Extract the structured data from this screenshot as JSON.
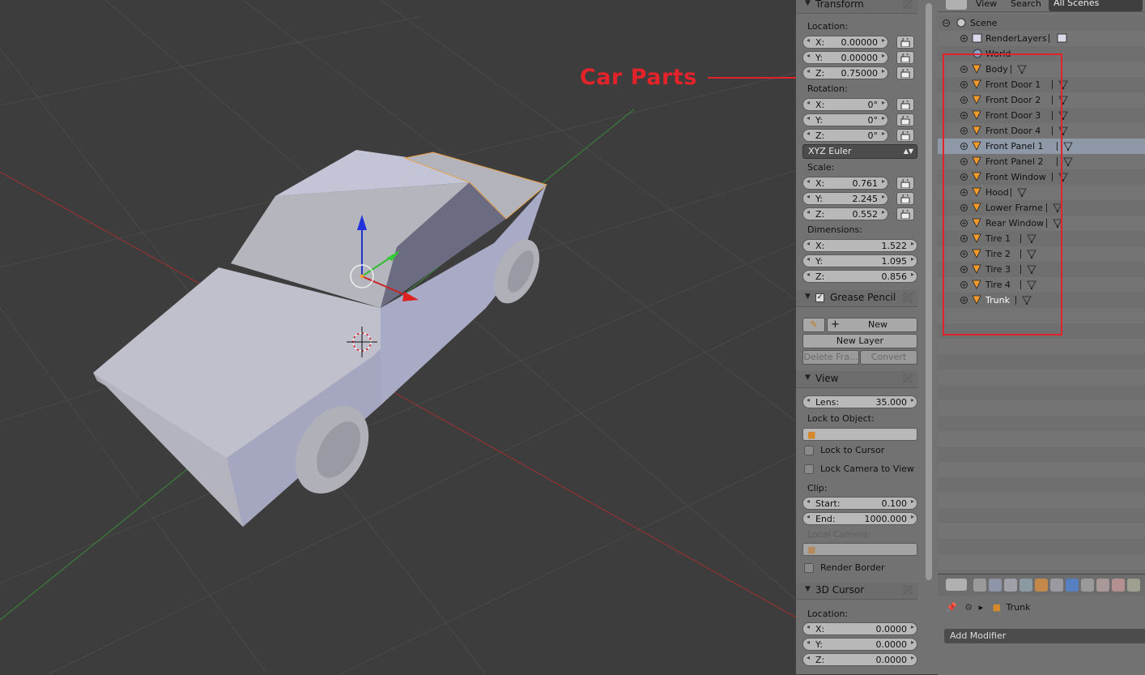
{
  "annotation": {
    "text": "Car Parts",
    "color": "#e3232a"
  },
  "transform": {
    "title": "Transform",
    "location_label": "Location:",
    "location": [
      {
        "axis": "X:",
        "value": "0.00000"
      },
      {
        "axis": "Y:",
        "value": "0.00000"
      },
      {
        "axis": "Z:",
        "value": "0.75000"
      }
    ],
    "rotation_label": "Rotation:",
    "rotation": [
      {
        "axis": "X:",
        "value": "0°"
      },
      {
        "axis": "Y:",
        "value": "0°"
      },
      {
        "axis": "Z:",
        "value": "0°"
      }
    ],
    "rotation_mode": "XYZ Euler",
    "scale_label": "Scale:",
    "scale": [
      {
        "axis": "X:",
        "value": "0.761"
      },
      {
        "axis": "Y:",
        "value": "2.245"
      },
      {
        "axis": "Z:",
        "value": "0.552"
      }
    ],
    "dimensions_label": "Dimensions:",
    "dimensions": [
      {
        "axis": "X:",
        "value": "1.522"
      },
      {
        "axis": "Y:",
        "value": "1.095"
      },
      {
        "axis": "Z:",
        "value": "0.856"
      }
    ]
  },
  "grease_pencil": {
    "title": "Grease Pencil",
    "new_label": "New",
    "new_layer_label": "New Layer",
    "delete_label": "Delete Fra...",
    "convert_label": "Convert"
  },
  "view": {
    "title": "View",
    "lens_label": "Lens:",
    "lens_value": "35.000",
    "lock_to_object_label": "Lock to Object:",
    "lock_to_cursor_label": "Lock to Cursor",
    "lock_camera_label": "Lock Camera to View",
    "clip_label": "Clip:",
    "clip_start_label": "Start:",
    "clip_start_value": "0.100",
    "clip_end_label": "End:",
    "clip_end_value": "1000.000",
    "local_camera_label": "Local Camera:",
    "render_border_label": "Render Border"
  },
  "cursor3d": {
    "title": "3D Cursor",
    "location_label": "Location:",
    "location": [
      {
        "axis": "X:",
        "value": "0.0000"
      },
      {
        "axis": "Y:",
        "value": "0.0000"
      },
      {
        "axis": "Z:",
        "value": "0.0000"
      }
    ]
  },
  "outliner": {
    "view_label": "View",
    "search_label": "Search",
    "scenes_label": "All Scenes",
    "scene_label": "Scene",
    "render_layers_label": "RenderLayers",
    "world_label": "World",
    "objects": [
      "Body",
      "Front Door 1",
      "Front Door 2",
      "Front Door 3",
      "Front Door 4",
      "Front Panel 1",
      "Front Panel 2",
      "Front Window",
      "Hood",
      "Lower Frame",
      "Rear Window",
      "Tire 1",
      "Tire 2",
      "Tire 3",
      "Tire 4",
      "Trunk"
    ],
    "selected_object": "Trunk",
    "highlight_row": "Front Panel 1"
  },
  "properties": {
    "breadcrumb_object": "Trunk",
    "add_modifier_label": "Add Modifier"
  }
}
